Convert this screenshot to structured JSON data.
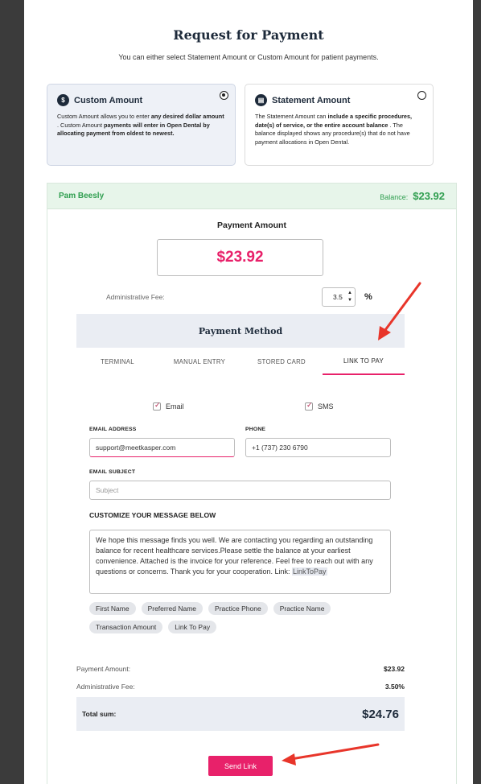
{
  "modal": {
    "title": "Request for Payment",
    "subtitle": "You can either select Statement Amount or Custom Amount for patient payments.",
    "close": "×"
  },
  "options": {
    "custom": {
      "title": "Custom Amount",
      "selected": true,
      "desc_plain_1": "Custom Amount allows you to enter ",
      "desc_bold_1": "any desired dollar amount",
      "desc_plain_2": " . Custom Amount ",
      "desc_bold_2": "payments will enter in Open Dental by allocating payment from oldest to newest."
    },
    "statement": {
      "title": "Statement Amount",
      "selected": false,
      "desc_plain_1": "The Statement Amount can ",
      "desc_bold_1": "include a specific procedures, date(s) of service, or the entire account balance",
      "desc_plain_2": " . The balance displayed shows any procedure(s) that do not have payment allocations in Open Dental."
    }
  },
  "patient": {
    "name": "Pam Beesly",
    "balance_label": "Balance:",
    "balance_value": "$23.92"
  },
  "payment": {
    "amount_label": "Payment Amount",
    "amount_value": "$23.92",
    "admin_fee_label": "Administrative Fee:",
    "admin_fee_value": "3.5",
    "percent": "%"
  },
  "method": {
    "title": "Payment Method",
    "tabs": [
      "TERMINAL",
      "MANUAL ENTRY",
      "STORED CARD",
      "LINK TO PAY"
    ],
    "active_tab": "LINK TO PAY"
  },
  "link_to_pay": {
    "email_check_label": "Email",
    "sms_check_label": "SMS",
    "email_label": "EMAIL ADDRESS",
    "email_value": "support@meetkasper.com",
    "phone_label": "PHONE",
    "phone_value": "+1 (737) 230 6790",
    "subject_label": "EMAIL SUBJECT",
    "subject_placeholder": "Subject",
    "customize_label": "CUSTOMIZE YOUR MESSAGE BELOW",
    "message_text": "We hope this message finds you well. We are contacting you regarding an outstanding balance for recent healthcare services.Please settle the balance at your earliest convenience. Attached is the invoice for your reference. Feel free to reach out with any questions or concerns. Thank you for your cooperation. Link: ",
    "message_link_token": "LinkToPay",
    "chips": [
      "First Name",
      "Preferred Name",
      "Practice Phone",
      "Practice Name",
      "Transaction Amount",
      "Link To Pay"
    ]
  },
  "summary": {
    "payment_amount_label": "Payment Amount:",
    "payment_amount_value": "$23.92",
    "admin_fee_label": "Administrative Fee:",
    "admin_fee_value": "3.50%",
    "total_label": "Total sum:",
    "total_value": "$24.76"
  },
  "send_button": "Send Link",
  "colors": {
    "accent": "#e8216a",
    "success": "#2f9e4f",
    "navy": "#1d2a3a",
    "annotation_arrow": "#e8352a"
  },
  "icons": {
    "custom": "dollar-card-icon",
    "statement": "statement-doc-icon",
    "close": "close-icon",
    "spinner": "stepper-arrows-icon"
  }
}
